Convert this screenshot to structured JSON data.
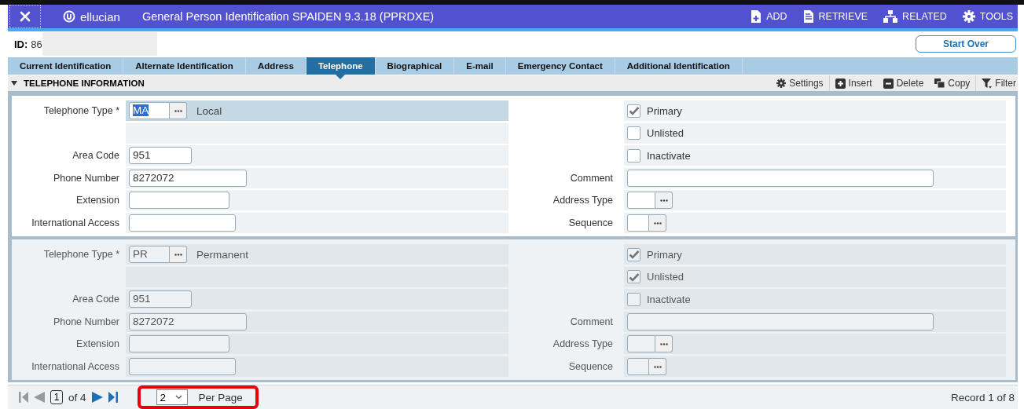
{
  "header": {
    "brand": "ellucian",
    "title": "General Person Identification SPAIDEN 9.3.18 (PPRDXE)",
    "actions": [
      {
        "kind": "add",
        "label": "ADD"
      },
      {
        "kind": "retrieve",
        "label": "RETRIEVE"
      },
      {
        "kind": "related",
        "label": "RELATED"
      },
      {
        "kind": "tools",
        "label": "TOOLS"
      }
    ]
  },
  "key_block": {
    "id_label": "ID:",
    "id_value": "86",
    "start_over": "Start Over"
  },
  "tabs": [
    {
      "label": "Current Identification",
      "selected": false
    },
    {
      "label": "Alternate Identification",
      "selected": false
    },
    {
      "label": "Address",
      "selected": false
    },
    {
      "label": "Telephone",
      "selected": true
    },
    {
      "label": "Biographical",
      "selected": false
    },
    {
      "label": "E-mail",
      "selected": false
    },
    {
      "label": "Emergency Contact",
      "selected": false
    },
    {
      "label": "Additional Identification",
      "selected": false
    }
  ],
  "section": {
    "title": "TELEPHONE INFORMATION",
    "expanded": true,
    "tools": [
      {
        "kind": "settings",
        "label": "Settings"
      },
      {
        "kind": "insert",
        "label": "Insert"
      },
      {
        "kind": "delete",
        "label": "Delete"
      },
      {
        "kind": "copy",
        "label": "Copy"
      },
      {
        "kind": "filter",
        "label": "Filter"
      }
    ]
  },
  "records": [
    {
      "selected": true,
      "left": [
        {
          "kind": "lookup",
          "label": "Telephone Type *",
          "value": "MA",
          "description": "Local"
        },
        {
          "kind": "blank"
        },
        {
          "kind": "text",
          "label": "Area Code",
          "value": "951"
        },
        {
          "kind": "text",
          "label": "Phone Number",
          "value": "8272072"
        },
        {
          "kind": "text",
          "label": "Extension"
        },
        {
          "kind": "text",
          "label": "International Access"
        }
      ],
      "right": [
        {
          "kind": "checkbox",
          "label": "Primary",
          "checked": true
        },
        {
          "kind": "checkbox",
          "label": "Unlisted",
          "checked": false
        },
        {
          "kind": "checkbox",
          "label": "Inactivate",
          "checked": false
        },
        {
          "kind": "text",
          "label": "Comment"
        },
        {
          "kind": "lookup",
          "label": "Address Type"
        },
        {
          "kind": "lookup",
          "label": "Sequence"
        }
      ]
    },
    {
      "selected": false,
      "left": [
        {
          "kind": "lookup",
          "label": "Telephone Type *",
          "value": "PR",
          "description": "Permanent"
        },
        {
          "kind": "blank"
        },
        {
          "kind": "text",
          "label": "Area Code",
          "value": "951"
        },
        {
          "kind": "text",
          "label": "Phone Number",
          "value": "8272072"
        },
        {
          "kind": "text",
          "label": "Extension"
        },
        {
          "kind": "text",
          "label": "International Access"
        }
      ],
      "right": [
        {
          "kind": "checkbox",
          "label": "Primary",
          "checked": true
        },
        {
          "kind": "checkbox",
          "label": "Unlisted",
          "checked": true
        },
        {
          "kind": "checkbox",
          "label": "Inactivate",
          "checked": false
        },
        {
          "kind": "text",
          "label": "Comment"
        },
        {
          "kind": "lookup",
          "label": "Address Type"
        },
        {
          "kind": "lookup",
          "label": "Sequence"
        }
      ]
    }
  ],
  "pager": {
    "page": "1",
    "of_pages": "of 4",
    "per_page": "2",
    "per_page_label": "Per Page",
    "record_status": "Record 1 of 8"
  }
}
